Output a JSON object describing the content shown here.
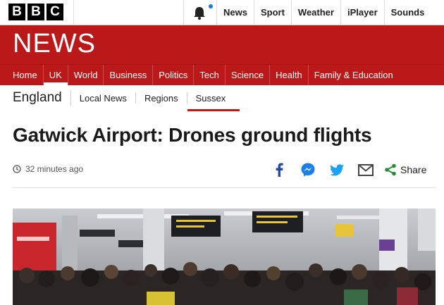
{
  "masthead": {
    "logo_letters": [
      "B",
      "B",
      "C"
    ],
    "notification_icon": "bell-icon",
    "accent_color": "#1a7bd1"
  },
  "top_nav": [
    "News",
    "Sport",
    "Weather",
    "iPlayer",
    "Sounds"
  ],
  "section": {
    "wordmark": "NEWS",
    "brand_color": "#bb1919"
  },
  "main_nav": {
    "items": [
      "Home",
      "UK",
      "World",
      "Business",
      "Politics",
      "Tech",
      "Science",
      "Health",
      "Family & Education"
    ],
    "active": "UK"
  },
  "sub_nav": {
    "region": "England",
    "items": [
      "Local News",
      "Regions",
      "Sussex"
    ],
    "current": "Sussex"
  },
  "article": {
    "headline": "Gatwick Airport: Drones ground flights",
    "timestamp": "32 minutes ago",
    "share_label": "Share",
    "share_icons": [
      "facebook-icon",
      "messenger-icon",
      "twitter-icon",
      "email-icon",
      "share-icon"
    ]
  }
}
